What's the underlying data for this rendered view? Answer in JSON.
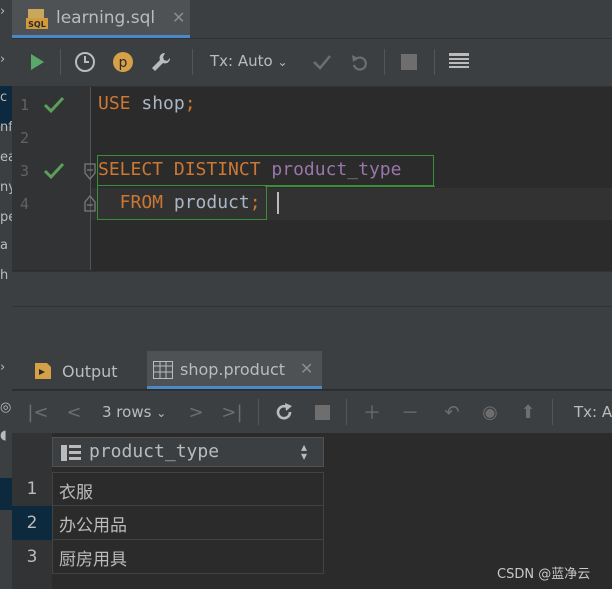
{
  "editor_tab": {
    "title": "learning.sql",
    "close": "✕",
    "file_icon": "sql-file-icon"
  },
  "toolbar": {
    "run_icon": "play-icon",
    "history_icon": "clock-icon",
    "profile_label": "p",
    "settings_icon": "wrench-icon",
    "tx_label": "Tx: Auto",
    "commit_icon": "check-icon",
    "rollback_icon": "undo-icon",
    "stop_icon": "stop-icon",
    "table_icon": "table-icon"
  },
  "editor": {
    "lines": [
      {
        "number": "1",
        "status": "ok",
        "tokens": [
          {
            "type": "kw",
            "text": "USE"
          },
          {
            "type": "id",
            "text": " shop"
          },
          {
            "type": "kw",
            "text": ";"
          }
        ]
      },
      {
        "number": "2",
        "status": "",
        "tokens": []
      },
      {
        "number": "3",
        "status": "ok",
        "tokens": [
          {
            "type": "kw",
            "text": "SELECT DISTINCT"
          },
          {
            "type": "id",
            "text": " "
          },
          {
            "type": "col",
            "text": "product_type"
          }
        ]
      },
      {
        "number": "4",
        "status": "",
        "tokens": [
          {
            "type": "kw",
            "text": "  FROM"
          },
          {
            "type": "id",
            "text": " product"
          },
          {
            "type": "kw",
            "text": ";"
          }
        ]
      }
    ]
  },
  "left_strip": {
    "fragments": [
      "c",
      "nf",
      "ea",
      "ny",
      "pe",
      "a",
      "h"
    ]
  },
  "results": {
    "tabs": [
      {
        "label": "Output"
      },
      {
        "label": "shop.product"
      }
    ],
    "tab_close": "✕",
    "rows_label": "3 rows",
    "tx_label": "Tx: A",
    "column_header": "product_type",
    "row_numbers": [
      "1",
      "2",
      "3"
    ],
    "rows": [
      "衣服",
      "办公用品",
      "厨房用具"
    ]
  },
  "watermark": "CSDN @蓝净云",
  "colors": {
    "accent": "#4a88c7",
    "keyword": "#cc7832",
    "column": "#9876aa",
    "ok_check": "#5aa05a",
    "run_green": "#59a869"
  }
}
